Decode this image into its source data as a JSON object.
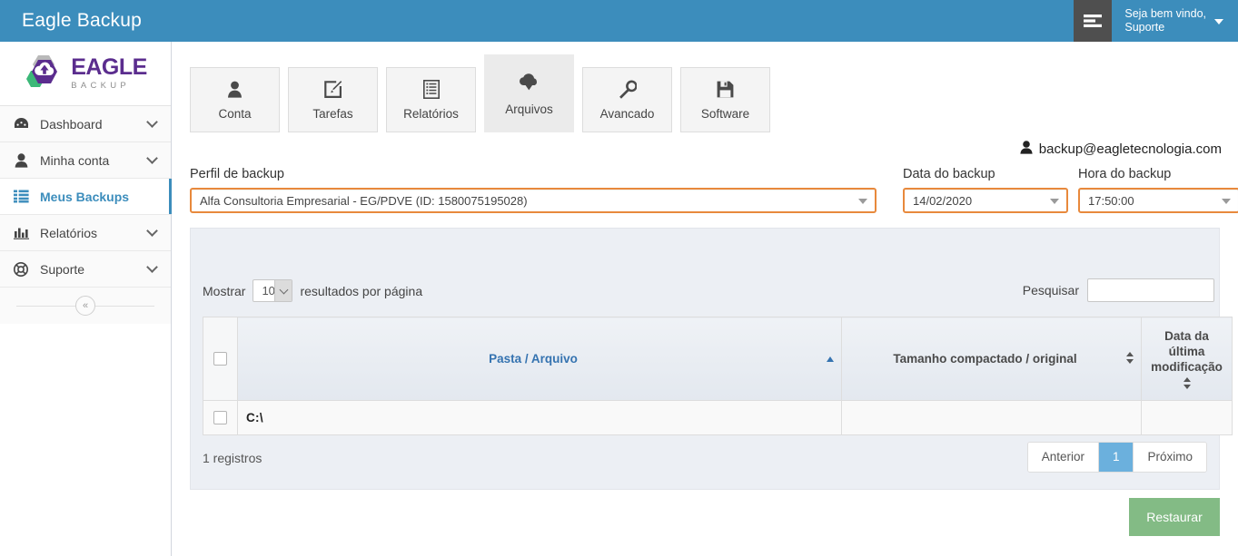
{
  "topbar": {
    "title": "Eagle Backup",
    "menu_icon": "stacked-bars-icon",
    "welcome_line1": "Seja bem vindo,",
    "welcome_line2": "Suporte",
    "bg_color": "#3c8dbc"
  },
  "sidebar": {
    "logo": {
      "primary": "EAGLE",
      "secondary": "BACKUP",
      "primary_color": "#5b2d8e"
    },
    "items": [
      {
        "label": "Dashboard",
        "icon": "dashboard-icon",
        "has_chevron": true,
        "active": false
      },
      {
        "label": "Minha conta",
        "icon": "user-icon",
        "has_chevron": true,
        "active": false
      },
      {
        "label": "Meus Backups",
        "icon": "list-icon",
        "has_chevron": false,
        "active": true
      },
      {
        "label": "Relatórios",
        "icon": "bar-chart-icon",
        "has_chevron": true,
        "active": false
      },
      {
        "label": "Suporte",
        "icon": "lifebuoy-icon",
        "has_chevron": true,
        "active": false
      }
    ],
    "collapse_glyph": "«"
  },
  "tabs": [
    {
      "label": "Conta",
      "icon": "person-icon",
      "active": false
    },
    {
      "label": "Tarefas",
      "icon": "pencil-square-icon",
      "active": false
    },
    {
      "label": "Relatórios",
      "icon": "report-list-icon",
      "active": false
    },
    {
      "label": "Arquivos",
      "icon": "cloud-download-icon",
      "active": true
    },
    {
      "label": "Avancado",
      "icon": "wrench-icon",
      "active": false
    },
    {
      "label": "Software",
      "icon": "floppy-disk-icon",
      "active": false
    }
  ],
  "account": {
    "email": "backup@eagletecnologia.com",
    "icon": "user-icon"
  },
  "filters": {
    "highlight_color": "#e8893c",
    "profile": {
      "label": "Perfil de backup",
      "value": "Alfa Consultoria Empresarial - EG/PDVE (ID: 1580075195028)"
    },
    "date": {
      "label": "Data do backup",
      "value": "14/02/2020"
    },
    "time": {
      "label": "Hora do backup",
      "value": "17:50:00"
    }
  },
  "table_controls": {
    "show_prefix": "Mostrar",
    "page_size": "10",
    "show_suffix": "resultados por página",
    "search_label": "Pesquisar",
    "search_value": "",
    "search_placeholder": ""
  },
  "table": {
    "columns": [
      {
        "key": "check",
        "label": "",
        "sort": "none"
      },
      {
        "key": "name",
        "label": "Pasta / Arquivo",
        "sort": "asc"
      },
      {
        "key": "size",
        "label": "Tamanho compactado / original",
        "sort": "both"
      },
      {
        "key": "mod",
        "label": "Data da última modificação",
        "sort": "both"
      }
    ],
    "rows": [
      {
        "name": "C:\\",
        "size": "",
        "mod": ""
      }
    ]
  },
  "footer": {
    "record_count": "1 registros",
    "pagination": {
      "previous": "Anterior",
      "pages": [
        "1"
      ],
      "next": "Próximo",
      "active_page": "1",
      "active_color": "#6bb0dd"
    }
  },
  "actions": {
    "restore_label": "Restaurar",
    "restore_color": "#83bb85"
  }
}
